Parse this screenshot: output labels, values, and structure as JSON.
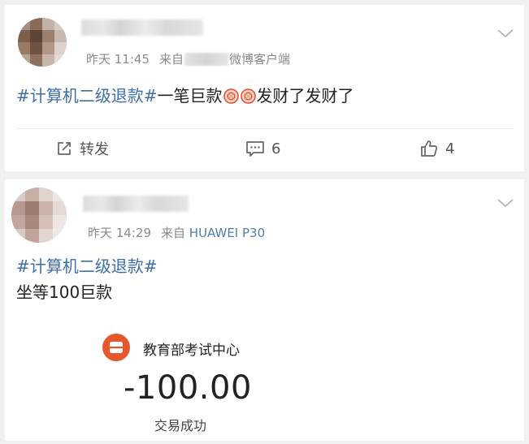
{
  "posts": [
    {
      "time": "昨天 11:45",
      "source_prefix": "来自",
      "source_suffix": "微博客户端",
      "hashtag": "#计算机二级退款#",
      "text_before_emoji": "一笔巨款",
      "text_after_emoji": "发财了发财了",
      "emoji_icons": [
        "fortune-emoji-icon",
        "fortune-emoji-icon"
      ],
      "actions": {
        "repost_label": "转发",
        "comment_count": "6",
        "like_count": "4"
      }
    },
    {
      "time": "昨天 14:29",
      "source_prefix": "来自",
      "device": "HUAWEI P30",
      "hashtag": "#计算机二级退款#",
      "body": "坐等100巨款",
      "receipt": {
        "org": "教育部考试中心",
        "amount": "-100.00",
        "status": "交易成功"
      }
    }
  ],
  "colors": {
    "hashtag": "#3e6ea8",
    "device_link": "#4f7ea8",
    "receipt_logo": "#e8572c",
    "meta_text": "#8a8a8a"
  }
}
